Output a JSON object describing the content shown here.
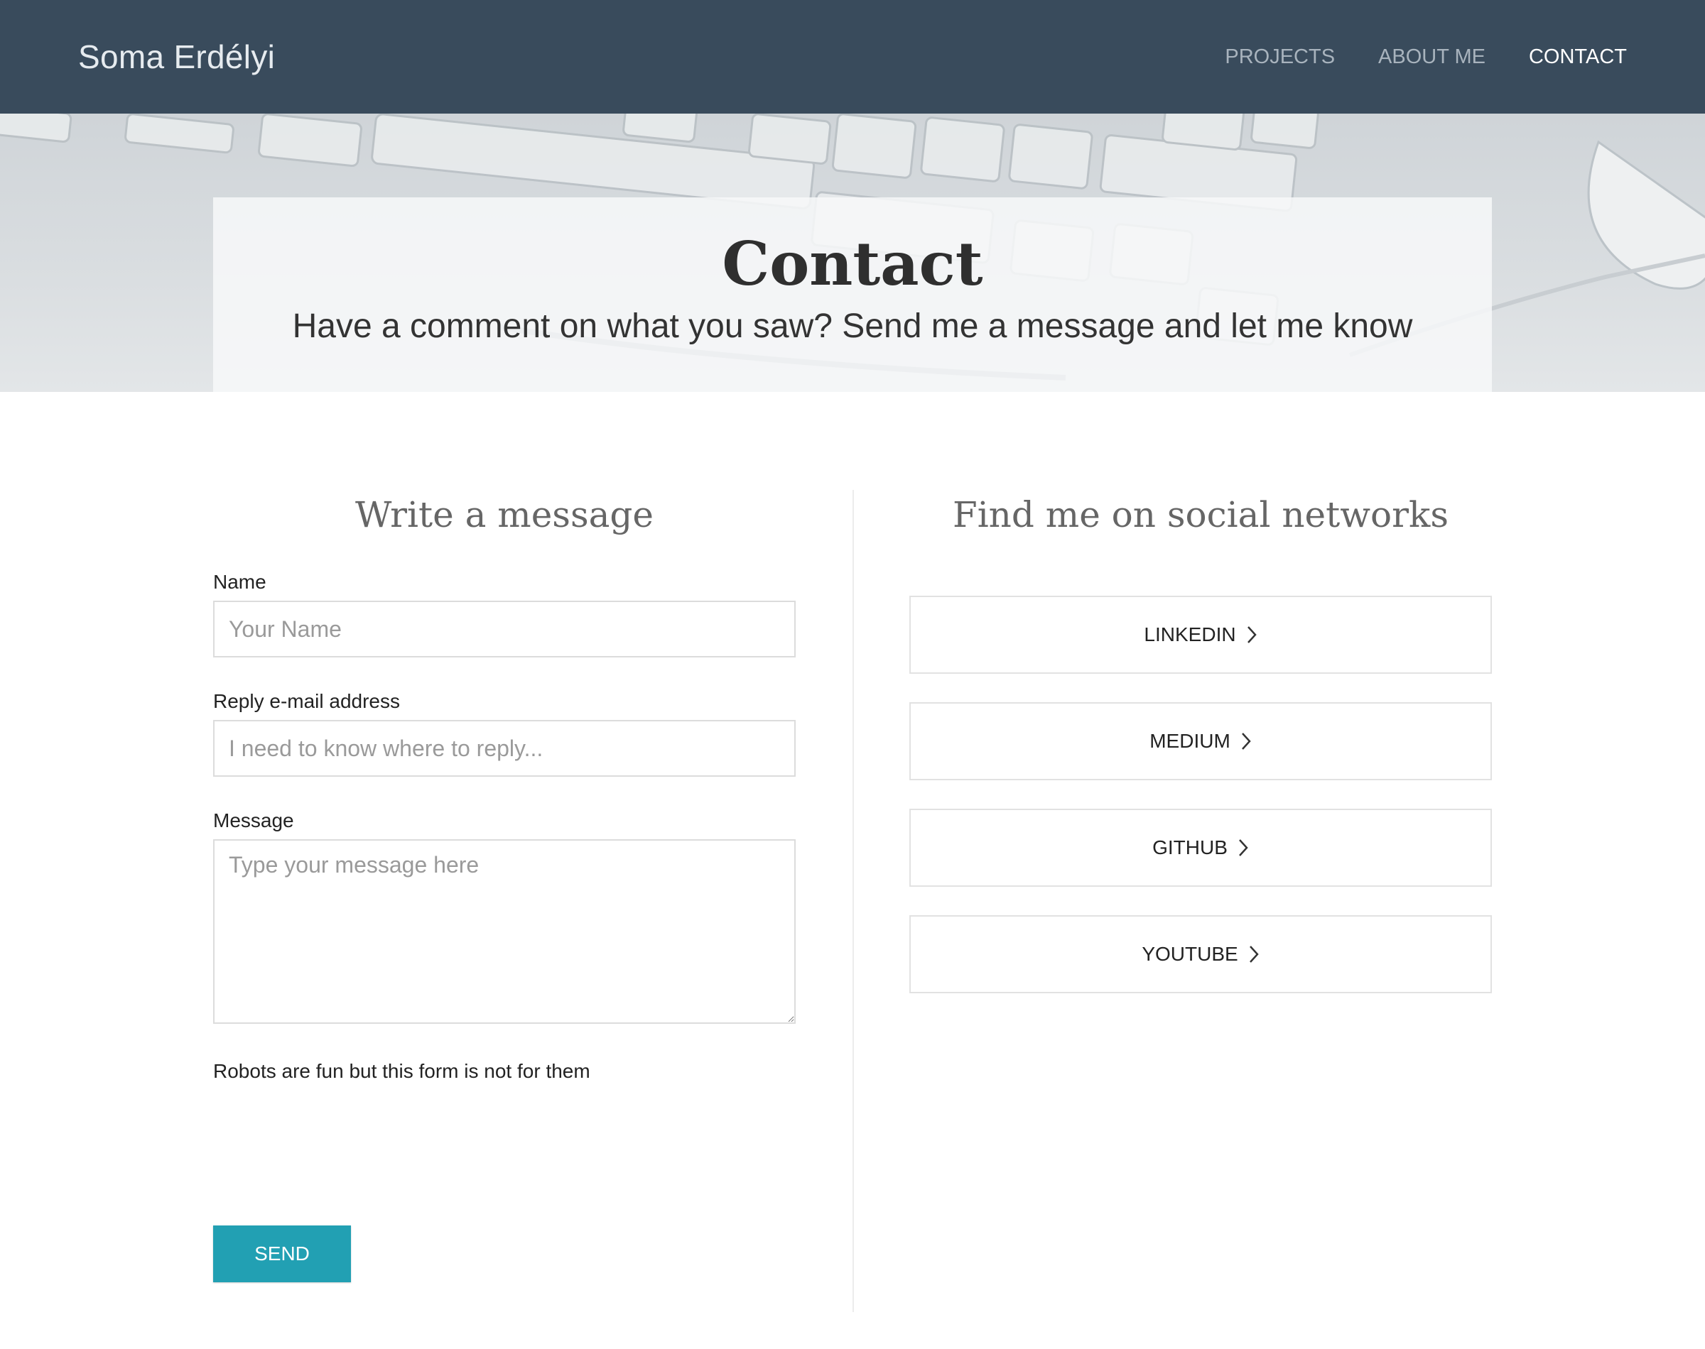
{
  "brand": "Soma Erdélyi",
  "nav": [
    {
      "label": "PROJECTS",
      "active": false
    },
    {
      "label": "ABOUT ME",
      "active": false
    },
    {
      "label": "CONTACT",
      "active": true
    }
  ],
  "hero": {
    "title": "Contact",
    "subtitle": "Have a comment on what you saw? Send me a message and let me know"
  },
  "form": {
    "title": "Write a message",
    "name_label": "Name",
    "name_placeholder": "Your Name",
    "email_label": "Reply e-mail address",
    "email_placeholder": "I need to know where to reply...",
    "message_label": "Message",
    "message_placeholder": "Type your message here",
    "robot_note": "Robots are fun but this form is not for them",
    "send_label": "SEND"
  },
  "social": {
    "title": "Find me on social networks",
    "links": [
      {
        "label": "LINKEDIN"
      },
      {
        "label": "MEDIUM"
      },
      {
        "label": "GITHUB"
      },
      {
        "label": "YOUTUBE"
      }
    ]
  },
  "colors": {
    "navbar": "#394b5c",
    "accent": "#22a0b3"
  }
}
